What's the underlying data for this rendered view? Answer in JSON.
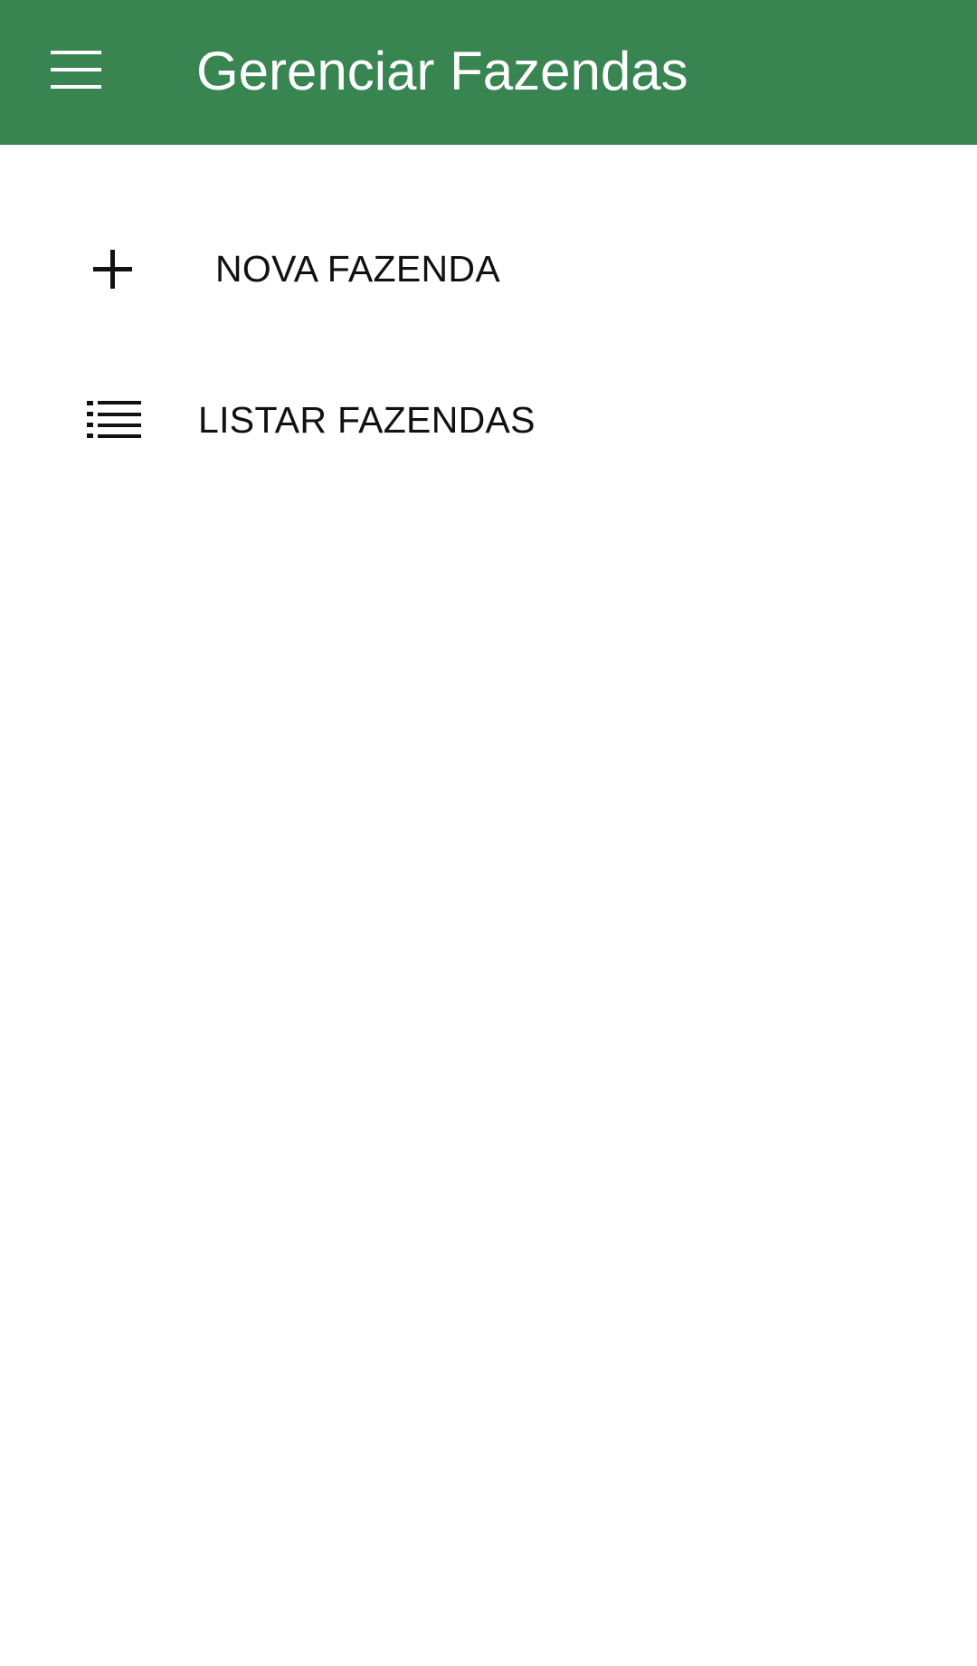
{
  "app_bar": {
    "title": "Gerenciar Fazendas",
    "menu_icon": "hamburger-menu-icon",
    "background_color": "#388552",
    "text_color": "#ffffff"
  },
  "actions": [
    {
      "label": "NOVA FAZENDA",
      "icon": "plus-icon"
    },
    {
      "label": "LISTAR FAZENDAS",
      "icon": "list-icon"
    }
  ]
}
